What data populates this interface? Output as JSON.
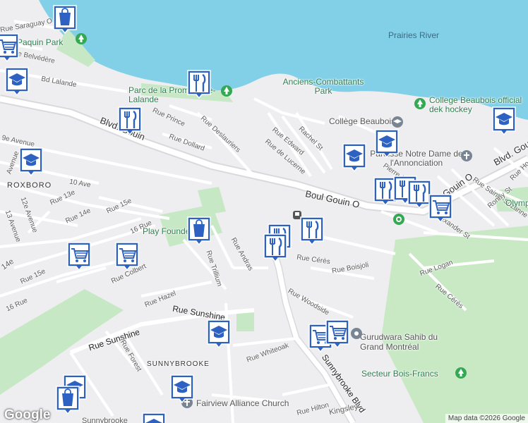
{
  "water": {
    "label": "Prairies River",
    "color": "#81d0e8"
  },
  "colors": {
    "land": "#eeeef0",
    "park": "#c6e8c4",
    "road": "#ffffff",
    "major_road": "#d9d9dc",
    "pin": "#2d62c2",
    "pin_border": "#ffffff"
  },
  "street_labels": [
    "Rue Saraguay O",
    "Rue Belvédère",
    "Bd Lalande",
    "Rue Prince",
    "Rue Dollard",
    "Rue Deslauriers",
    "Blvd. Gouin",
    "9e Avenue",
    "Avenue",
    "10 Ave",
    "Rue 13e",
    "12e Avenue",
    "13 Avenue",
    "Rue 14e",
    "Rue 15e",
    "16 Rue",
    "14e",
    "Rue 15e",
    "16 Rue",
    "Rue Colbert",
    "Rue Edward",
    "Rue de Lucerne",
    "Rachel St",
    "Boul Gouin O",
    "Rue Trillium",
    "Rue Andras",
    "Rue Hazel",
    "Rue Sunshine",
    "Rue Sunshine",
    "Rue Forest",
    "Sunnybrooke Blvd",
    "Rue Cérès",
    "Rue Boisjoli",
    "Rue Logan",
    "Rue Cérès",
    "Rue Woodside",
    "Rue Whiteoak",
    "Rue Hilton",
    "Kingsley",
    "Sunnybrooke",
    "Rue Sainte-Suzanne",
    "Ronny St",
    "Alexander St",
    "Blvd. Gouin",
    "Rue Ho",
    "Gouin O",
    "Pierre-L"
  ],
  "area_labels": [
    "ROXBORO",
    "SUNNYBROOKE"
  ],
  "places": {
    "paquin_park": "Paquin Park",
    "promenade": "Parc de la Promenade-Lalande",
    "anciens": "Anciens-Combattants Park",
    "college_dek": "College Beaubois official dek hockey",
    "college": "Collège Beaubois",
    "paroisse": "Paroisse Notre Dame de l'Annonciation",
    "play": "Play Founders",
    "gurudwara": "Gurudwara Sahib du Grand Montréal",
    "bois_francs": "Secteur Bois-Francs",
    "fairview": "Fairview Alliance Church",
    "olym": "Olymp"
  },
  "pins": [
    {
      "type": "shopping",
      "icon": "shopping-bag-icon"
    },
    {
      "type": "grocery",
      "icon": "shopping-cart-icon"
    },
    {
      "type": "school",
      "icon": "graduation-cap-icon"
    },
    {
      "type": "restaurant",
      "icon": "fork-knife-icon"
    },
    {
      "type": "restaurant",
      "icon": "fork-knife-icon"
    },
    {
      "type": "school",
      "icon": "graduation-cap-icon"
    },
    {
      "type": "school",
      "icon": "graduation-cap-icon"
    },
    {
      "type": "school",
      "icon": "graduation-cap-icon"
    },
    {
      "type": "school",
      "icon": "graduation-cap-icon"
    },
    {
      "type": "restaurant",
      "icon": "fork-knife-icon"
    },
    {
      "type": "restaurant",
      "icon": "fork-knife-icon"
    },
    {
      "type": "restaurant",
      "icon": "fork-knife-icon"
    },
    {
      "type": "grocery",
      "icon": "shopping-cart-icon"
    },
    {
      "type": "shopping",
      "icon": "shopping-bag-icon"
    },
    {
      "type": "restaurant",
      "icon": "fork-knife-icon"
    },
    {
      "type": "restaurant",
      "icon": "fork-knife-icon"
    },
    {
      "type": "restaurant",
      "icon": "fork-knife-icon"
    },
    {
      "type": "grocery",
      "icon": "shopping-cart-icon"
    },
    {
      "type": "grocery",
      "icon": "shopping-cart-icon"
    },
    {
      "type": "school",
      "icon": "graduation-cap-icon"
    },
    {
      "type": "grocery",
      "icon": "shopping-cart-icon"
    },
    {
      "type": "grocery",
      "icon": "shopping-cart-icon"
    },
    {
      "type": "school",
      "icon": "graduation-cap-icon"
    },
    {
      "type": "school",
      "icon": "graduation-cap-icon"
    },
    {
      "type": "shopping",
      "icon": "shopping-bag-icon"
    },
    {
      "type": "school",
      "icon": "graduation-cap-icon"
    }
  ],
  "logo": "Google",
  "attribution": "Map data ©2026 Google"
}
